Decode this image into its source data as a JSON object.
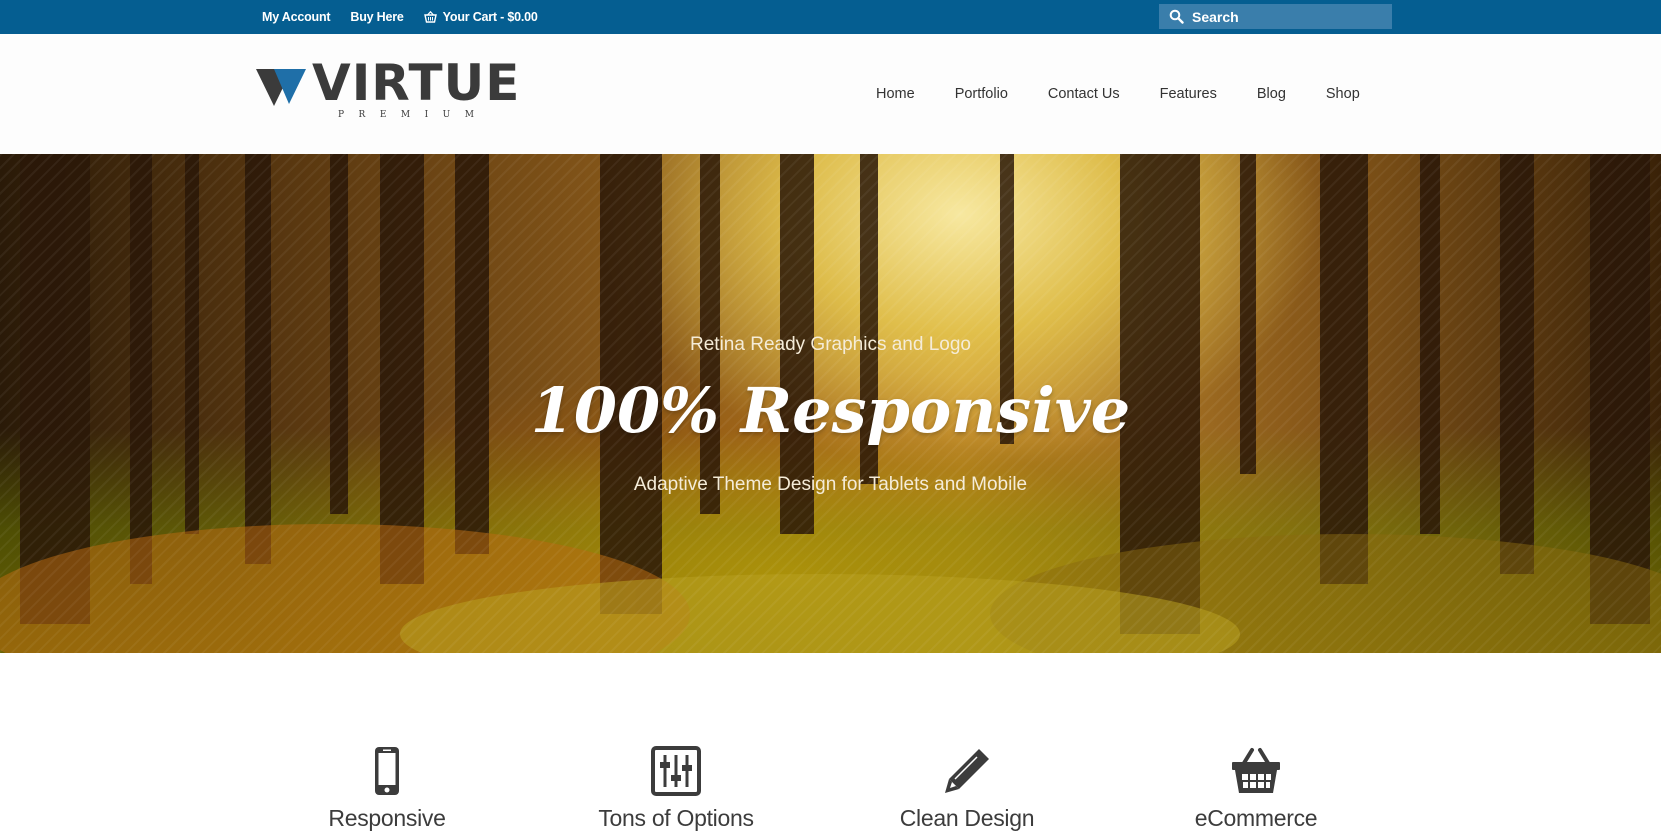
{
  "topbar": {
    "links": [
      {
        "label": "My Account"
      },
      {
        "label": "Buy Here"
      },
      {
        "label": "Your Cart - $0.00",
        "icon": "basket-icon"
      }
    ],
    "search": {
      "placeholder": "Search",
      "icon": "search-icon"
    }
  },
  "header": {
    "logo": {
      "word": "VIRTUE",
      "sub": "PREMIUM"
    },
    "nav": [
      "Home",
      "Portfolio",
      "Contact Us",
      "Features",
      "Blog",
      "Shop"
    ]
  },
  "hero": {
    "subtitle_top": "Retina Ready Graphics and Logo",
    "title": "100% Responsive",
    "subtitle_bottom": "Adaptive Theme Design for Tablets and Mobile"
  },
  "features": [
    {
      "title": "Responsive",
      "icon": "mobile-phone-icon"
    },
    {
      "title": "Tons of Options",
      "icon": "sliders-icon"
    },
    {
      "title": "Clean Design",
      "icon": "pencil-icon"
    },
    {
      "title": "eCommerce",
      "icon": "shopping-basket-icon"
    }
  ],
  "colors": {
    "topbar": "#055e91",
    "search_bg": "#3a7eab",
    "logo_accent": "#1f6fa8",
    "logo_dark": "#3b3b3b",
    "text_dark": "#333333"
  }
}
